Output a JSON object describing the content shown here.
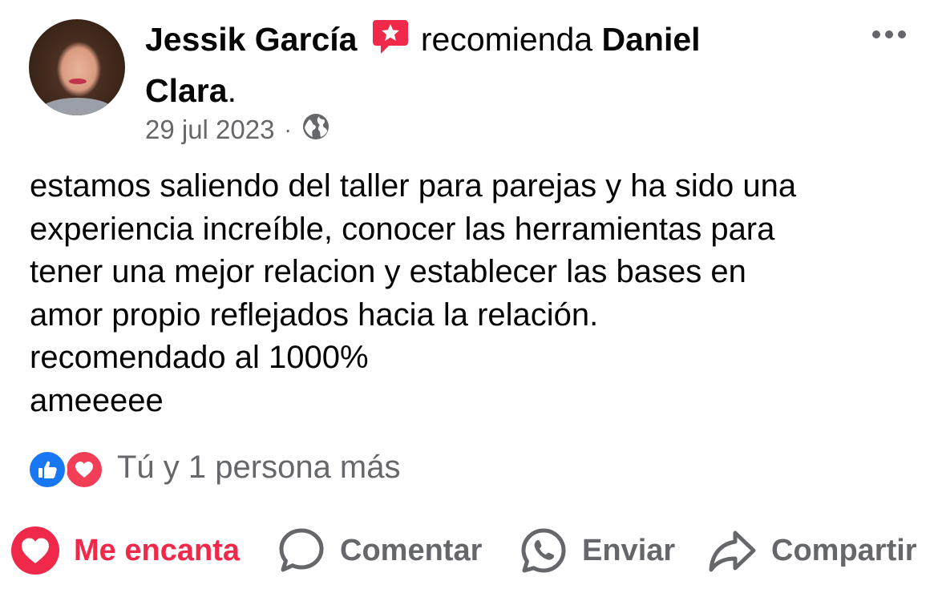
{
  "post": {
    "author": "Jessik García",
    "verb": "recomienda",
    "page_name_line1": "Daniel",
    "page_name_line2": "Clara",
    "page_name_end": ".",
    "date": "29 jul 2023",
    "separator": "·",
    "privacy_icon": "globe-icon",
    "body": "estamos saliendo del taller para parejas y ha sido una\nexperiencia increíble,  conocer las herramientas para\ntener una mejor relacion y establecer las bases en\namor propio reflejados hacia la relación.\nrecomendado al 1000%\nameeeee"
  },
  "reactions": {
    "icons": [
      "like-icon",
      "love-icon"
    ],
    "summary": "Tú y 1 persona más"
  },
  "actions": {
    "love_label": "Me encanta",
    "comment_label": "Comentar",
    "send_label": "Enviar",
    "share_label": "Compartir"
  },
  "colors": {
    "love_active": "#f02849",
    "like_blue": "#1877f2",
    "secondary_text": "#65676b",
    "recommend_badge": "#f02849"
  }
}
